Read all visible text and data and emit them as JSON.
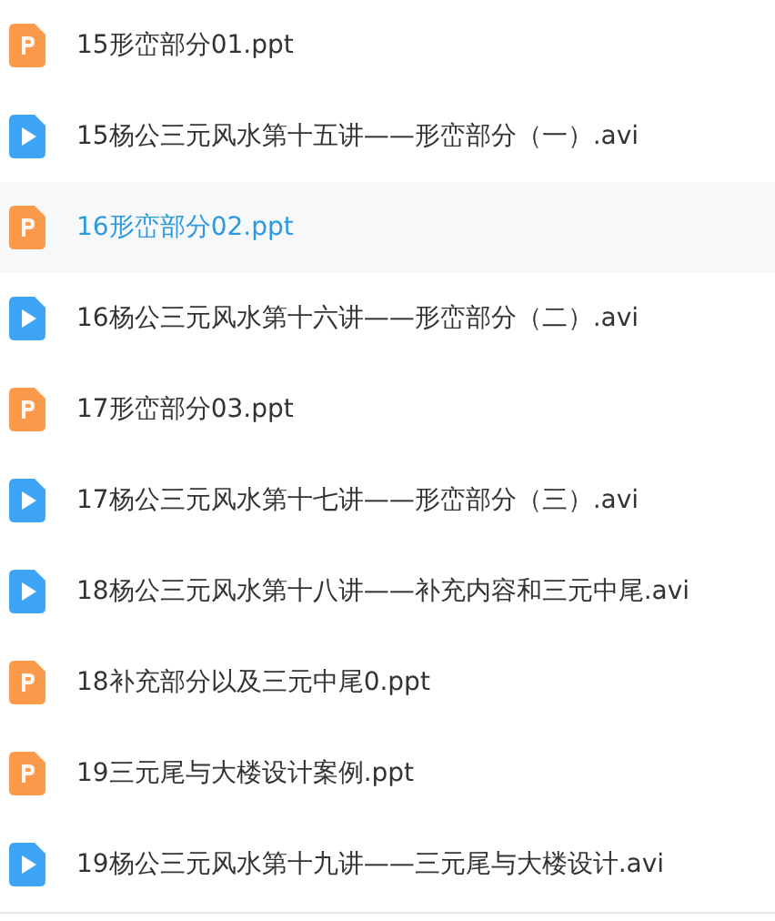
{
  "files": [
    {
      "name": "15形峦部分01.ppt",
      "kind": "ppt",
      "selected": false
    },
    {
      "name": "15杨公三元风水第十五讲——形峦部分（一）.avi",
      "kind": "video",
      "selected": false
    },
    {
      "name": "16形峦部分02.ppt",
      "kind": "ppt",
      "selected": true
    },
    {
      "name": "16杨公三元风水第十六讲——形峦部分（二）.avi",
      "kind": "video",
      "selected": false
    },
    {
      "name": "17形峦部分03.ppt",
      "kind": "ppt",
      "selected": false
    },
    {
      "name": "17杨公三元风水第十七讲——形峦部分（三）.avi",
      "kind": "video",
      "selected": false
    },
    {
      "name": "18杨公三元风水第十八讲——补充内容和三元中尾.avi",
      "kind": "video",
      "selected": false
    },
    {
      "name": "18补充部分以及三元中尾0.ppt",
      "kind": "ppt",
      "selected": false
    },
    {
      "name": "19三元尾与大楼设计案例.ppt",
      "kind": "ppt",
      "selected": false
    },
    {
      "name": "19杨公三元风水第十九讲——三元尾与大楼设计.avi",
      "kind": "video",
      "selected": false
    }
  ]
}
